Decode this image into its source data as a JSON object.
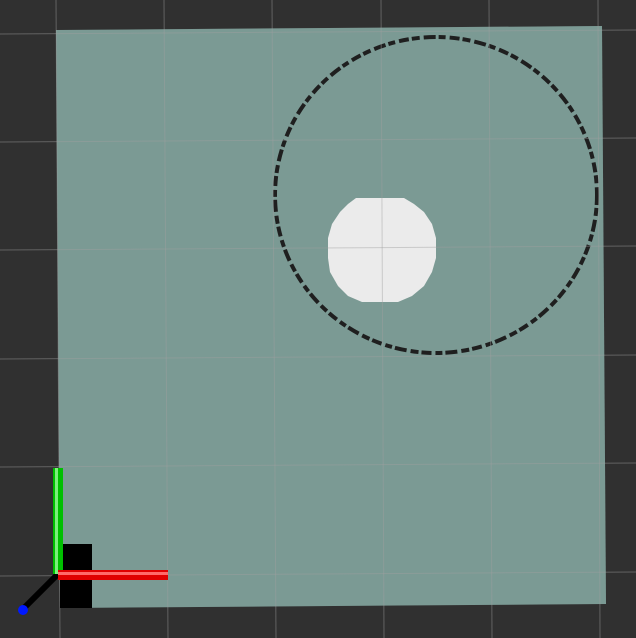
{
  "scene": {
    "background_color": "#303030",
    "grid_color": "#a0a0a0",
    "map_color": "#6f8b86",
    "map_overlay_color": "#9fc6c0",
    "obstacle_ring_color": "#1f1f1f",
    "free_blob_color": "#ebebeb"
  },
  "axes": {
    "x_axis_color": "#e00000",
    "y_axis_color": "#00c000",
    "z_axis_color": "#0018ff",
    "origin_block_color": "#000000"
  },
  "icons": {
    "axes": "tf-axes-icon"
  }
}
